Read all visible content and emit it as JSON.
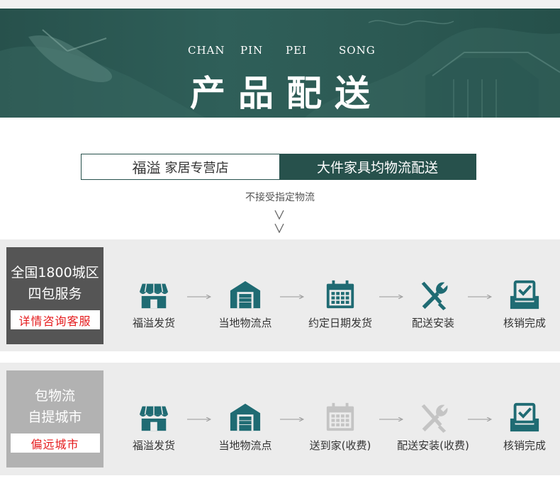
{
  "banner": {
    "pinyin": [
      "CHAN",
      "PIN",
      "PEI",
      "SONG"
    ],
    "title": "产品配送"
  },
  "tag": {
    "brand": "福溢",
    "store": "家居专营店",
    "right": "大件家具均物流配送"
  },
  "note": "不接受指定物流",
  "rows": [
    {
      "side_line1": "全国1800城区",
      "side_line2": "四包服务",
      "side_button": "详情咨询客服",
      "side_color": "#555555",
      "steps": [
        {
          "icon": "store-icon",
          "label": "福溢发货",
          "active": true
        },
        {
          "icon": "warehouse-icon",
          "label": "当地物流点",
          "active": true
        },
        {
          "icon": "calendar-icon",
          "label": "约定日期发货",
          "active": true
        },
        {
          "icon": "tools-icon",
          "label": "配送安装",
          "active": true
        },
        {
          "icon": "checkbox-tray-icon",
          "label": "核销完成",
          "active": true
        }
      ]
    },
    {
      "side_line1": "包物流",
      "side_line2": "自提城市",
      "side_button": "偏远城市",
      "side_color": "#b2b2b2",
      "steps": [
        {
          "icon": "store-icon",
          "label": "福溢发货",
          "active": true
        },
        {
          "icon": "warehouse-icon",
          "label": "当地物流点",
          "active": true
        },
        {
          "icon": "calendar-icon",
          "label": "送到家(收费)",
          "active": false
        },
        {
          "icon": "tools-icon",
          "label": "配送安装(收费)",
          "active": false
        },
        {
          "icon": "checkbox-tray-icon",
          "label": "核销完成",
          "active": true
        }
      ]
    }
  ],
  "colors": {
    "accent": "#27514c",
    "icon": "#1f6b73",
    "icon_inactive": "#c4c4c4",
    "alert": "#e5191b"
  }
}
